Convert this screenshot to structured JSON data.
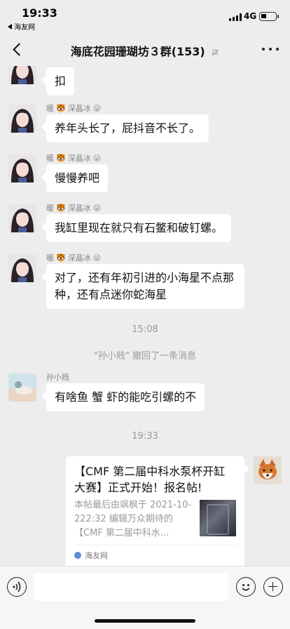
{
  "status_bar": {
    "time": "19:33",
    "back_app": "海友网",
    "network": "4G",
    "battery_level": 0.35
  },
  "header": {
    "title": "海底花园珊瑚坊３群(153)"
  },
  "messages": [
    {
      "sender": "",
      "text": "扣"
    },
    {
      "sender": "暖",
      "sender_extra": "深晶冰",
      "text": "养年头长了，屁抖音不长了。"
    },
    {
      "sender": "暖",
      "sender_extra": "深晶冰",
      "text": "慢慢养吧"
    },
    {
      "sender": "暖",
      "sender_extra": "深晶冰",
      "text": "我缸里现在就只有石鳖和破钉螺。"
    },
    {
      "sender": "暖",
      "sender_extra": "深晶冰",
      "text": "对了，还有年初引进的小海星不点那种，还有点迷你蛇海星"
    }
  ],
  "system": {
    "time_1": "15:08",
    "recall_notice": "\"孙小贱\" 撤回了一条消息",
    "time_2": "19:33"
  },
  "message_sun": {
    "sender": "孙小贱",
    "text": "有啥鱼  蟹  虾的能吃引螺的不"
  },
  "card": {
    "title": "【CMF 第二届中科水泵杯开缸大赛】正式开始！报名帖!",
    "desc": "本帖最后由飒枫于 2021-10-222:32 编辑万众期待的【CMF 第二届中科水...",
    "source": "海友网"
  }
}
